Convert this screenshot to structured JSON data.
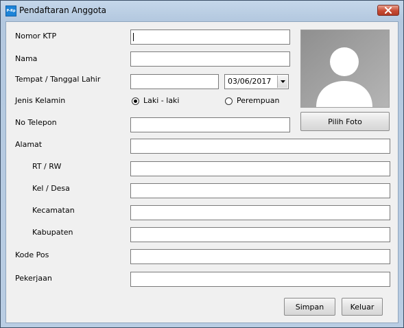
{
  "window": {
    "title": "Pendaftaran Anggota",
    "icon_text": "P-Rp",
    "close_icon": "close-icon"
  },
  "form": {
    "nomor_ktp": {
      "label": "Nomor KTP",
      "value": ""
    },
    "nama": {
      "label": "Nama",
      "value": ""
    },
    "ttl": {
      "label": "Tempat / Tanggal Lahir",
      "tempat_value": "",
      "tanggal_value": "03/06/2017"
    },
    "jenis_kelamin": {
      "label": "Jenis Kelamin",
      "options": [
        "Laki - laki",
        "Perempuan"
      ],
      "selected": "Laki - laki"
    },
    "no_telepon": {
      "label": "No Telepon",
      "value": ""
    },
    "alamat": {
      "label": "Alamat",
      "value": ""
    },
    "rt_rw": {
      "label": "RT / RW",
      "value": ""
    },
    "kel_desa": {
      "label": "Kel / Desa",
      "value": ""
    },
    "kecamatan": {
      "label": "Kecamatan",
      "value": ""
    },
    "kabupaten": {
      "label": "Kabupaten",
      "value": ""
    },
    "kode_pos": {
      "label": "Kode Pos",
      "value": ""
    },
    "pekerjaan": {
      "label": "Pekerjaan",
      "value": ""
    }
  },
  "photo": {
    "button_label": "Pilih Foto",
    "placeholder_icon": "user-silhouette-icon"
  },
  "buttons": {
    "simpan": "Simpan",
    "keluar": "Keluar"
  },
  "colors": {
    "title_bar": "#b9cde3",
    "close_button": "#c74a33",
    "client_bg": "#f0f0f0",
    "photo_bg": "#9d9d9d"
  }
}
